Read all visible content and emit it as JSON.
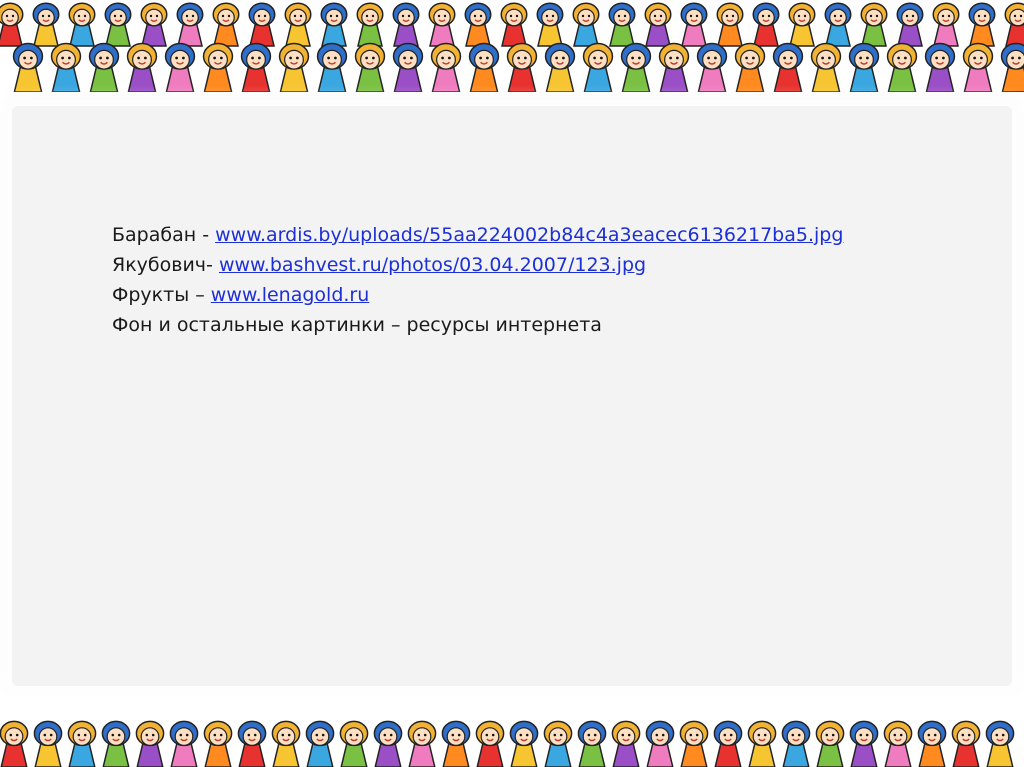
{
  "credits": [
    {
      "label": "Барабан  - ",
      "link": " www.ardis.by/uploads/55aa224002b84c4a3eacec6136217ba5.jpg"
    },
    {
      "label": "Якубович- ",
      "link": " www.bashvest.ru/photos/03.04.2007/123.jpg"
    },
    {
      "label": "Фрукты – ",
      "link": "www.lenagold.ru"
    },
    {
      "label": "Фон и остальные картинки – ресурсы интернета",
      "link": ""
    }
  ],
  "decor": {
    "border_image": "cartoon-children-border",
    "palette": [
      "#e8322f",
      "#f7c531",
      "#3aa7e0",
      "#7ac143",
      "#9b4fc6",
      "#f07cc0",
      "#ff8a1f"
    ]
  }
}
